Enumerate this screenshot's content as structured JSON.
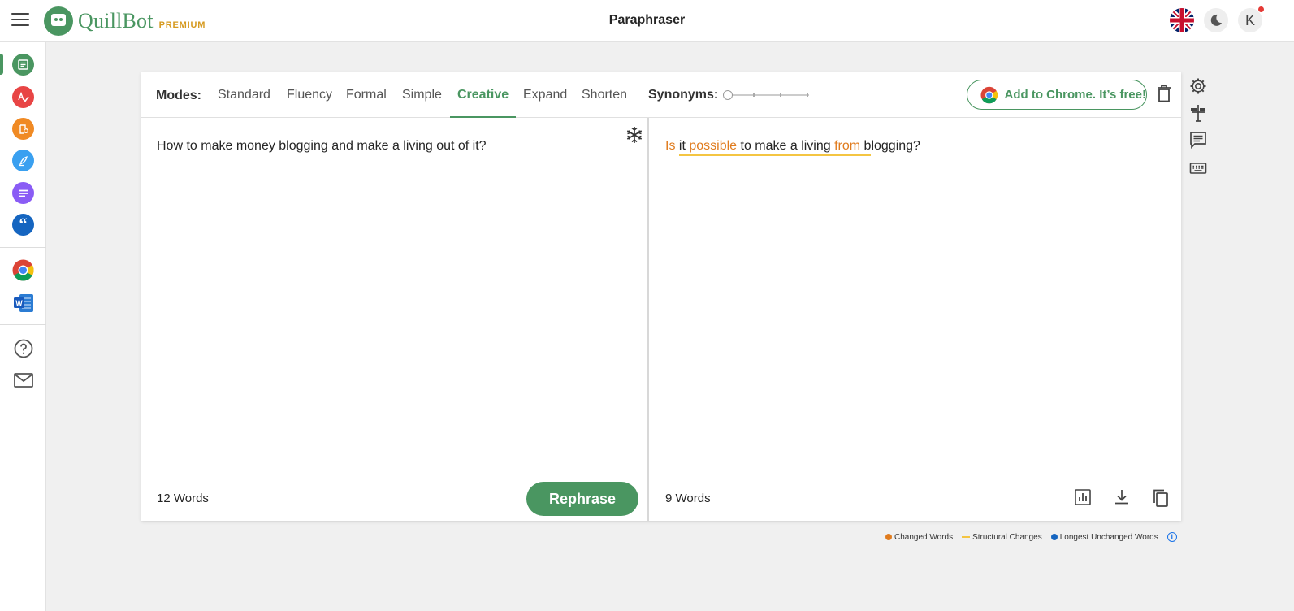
{
  "app": {
    "brand": "QuillBot",
    "tier": "PREMIUM",
    "page_title": "Paraphraser",
    "accent_color": "#4a9661",
    "avatar_initial": "K"
  },
  "sidebar": {
    "items": [
      {
        "name": "paraphraser",
        "icon": "paraphraser-icon",
        "color": "#4a9661",
        "active": true
      },
      {
        "name": "grammar-checker",
        "icon": "grammar-check-icon",
        "color": "#e84545"
      },
      {
        "name": "plagiarism-checker",
        "icon": "plagiarism-icon",
        "color": "#f08a24"
      },
      {
        "name": "co-writer",
        "icon": "pen-icon",
        "color": "#3aa0f0"
      },
      {
        "name": "summarizer",
        "icon": "summarizer-icon",
        "color": "#8a5cf5"
      },
      {
        "name": "citation-generator",
        "icon": "quote-icon",
        "color": "#1565c0"
      }
    ],
    "extensions": [
      "chrome-extension-icon",
      "word-addin-icon"
    ],
    "help": [
      "help-icon",
      "mail-icon"
    ]
  },
  "toolbar": {
    "modes_label": "Modes:",
    "modes": [
      "Standard",
      "Fluency",
      "Formal",
      "Simple",
      "Creative",
      "Expand",
      "Shorten"
    ],
    "active_mode": "Creative",
    "synonyms_label": "Synonyms:",
    "synonyms_level": 0,
    "chrome_button": "Add to Chrome. It’s free!"
  },
  "input": {
    "text": "How to make money blogging and make a living out of it?",
    "word_count": "12 Words",
    "rephrase_label": "Rephrase"
  },
  "output": {
    "segments": [
      {
        "text": "Is",
        "changed": true
      },
      {
        "text": " it ",
        "changed": false
      },
      {
        "text": "possible",
        "changed": true
      },
      {
        "text": " to make a living ",
        "changed": false
      },
      {
        "text": "from",
        "changed": true
      },
      {
        "text": " blogging?",
        "changed": false
      }
    ],
    "word_count": "9 Words"
  },
  "legend": {
    "changed": {
      "label": "Changed Words",
      "color": "#e07b1d"
    },
    "structural": {
      "label": "Structural Changes",
      "color": "#f4c542"
    },
    "unchanged": {
      "label": "Longest Unchanged Words",
      "color": "#1565c0"
    },
    "info": "i"
  }
}
